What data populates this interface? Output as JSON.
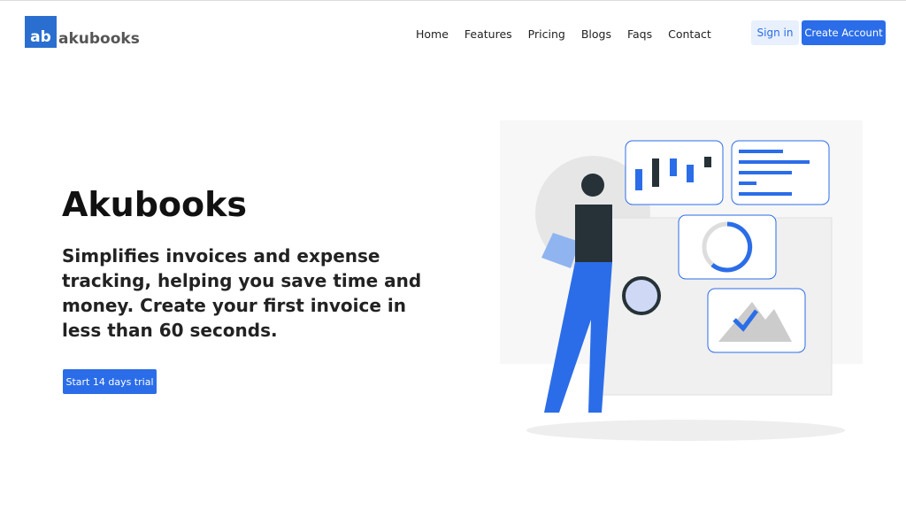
{
  "brand": {
    "logo_mark": "ab",
    "name": "akubooks"
  },
  "nav": {
    "items": [
      "Home",
      "Features",
      "Pricing",
      "Blogs",
      "Faqs",
      "Contact"
    ]
  },
  "header": {
    "signin": "Sign in",
    "create": "Create Account"
  },
  "hero": {
    "title": "Akubooks",
    "subtitle": "Simplifies invoices and expense tracking, helping you save time and money. Create your first invoice in less than 60 seconds.",
    "cta": "Start 14 days trial"
  },
  "colors": {
    "accent": "#2b6de8"
  }
}
